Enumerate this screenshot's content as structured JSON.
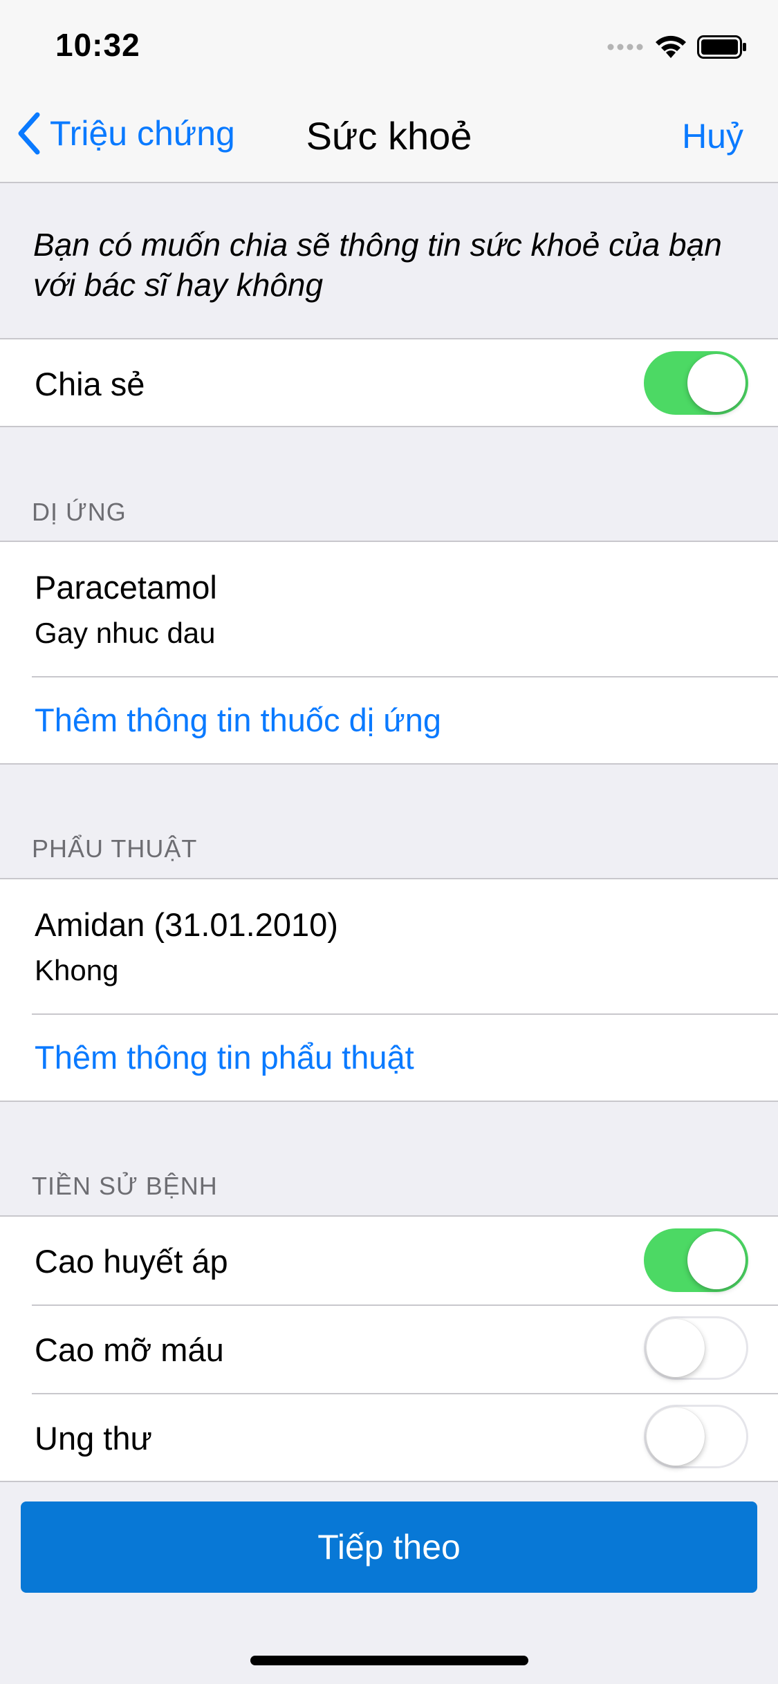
{
  "status_bar": {
    "time": "10:32",
    "icons": [
      "signal-icon",
      "wifi-icon",
      "battery-icon"
    ]
  },
  "nav": {
    "back_label": "Triệu chứng",
    "title": "Sức khoẻ",
    "cancel_label": "Huỷ"
  },
  "intro": {
    "text": "Bạn có muốn chia sẽ thông tin sức khoẻ của bạn với bác sĩ hay không"
  },
  "share": {
    "label": "Chia sẻ",
    "enabled": true
  },
  "allergy": {
    "header": "DỊ ỨNG",
    "items": [
      {
        "name": "Paracetamol",
        "note": "Gay nhuc dau"
      }
    ],
    "add_label": "Thêm thông tin thuốc dị ứng"
  },
  "surgery": {
    "header": "PHẨU THUẬT",
    "items": [
      {
        "name": "Amidan (31.01.2010)",
        "note": "Khong"
      }
    ],
    "add_label": "Thêm thông tin phẩu thuật"
  },
  "history": {
    "header": "TIỀN SỬ BỆNH",
    "items": [
      {
        "label": "Cao huyết áp",
        "enabled": true
      },
      {
        "label": "Cao mỡ máu",
        "enabled": false
      },
      {
        "label": "Ung thư",
        "enabled": false
      }
    ]
  },
  "footer": {
    "next_label": "Tiếp theo"
  },
  "colors": {
    "accent": "#0a7aff",
    "toggle_on": "#4cd964",
    "button": "#0878d6",
    "background": "#efeff4"
  }
}
